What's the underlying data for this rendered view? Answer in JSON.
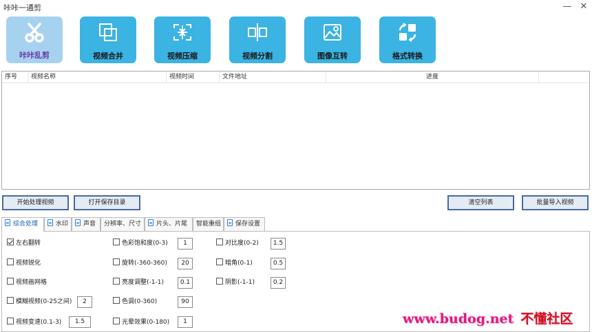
{
  "window": {
    "title": "咔咔一通剪",
    "minimize_symbol": "—",
    "close_symbol": "✕"
  },
  "toolbar": {
    "tools": [
      {
        "label": "咔咔乱剪",
        "icon": "scissors-icon",
        "active": true
      },
      {
        "label": "视频合并",
        "icon": "merge-icon"
      },
      {
        "label": "视频压缩",
        "icon": "compress-icon"
      },
      {
        "label": "视频分割",
        "icon": "split-icon"
      },
      {
        "label": "图像互转",
        "icon": "image-convert-icon"
      },
      {
        "label": "格式转换",
        "icon": "format-convert-icon"
      }
    ]
  },
  "list": {
    "columns": [
      "序号",
      "视频名称",
      "视频时间",
      "文件地址",
      "进度"
    ],
    "rows": []
  },
  "actions": {
    "start": "开始处理视频",
    "open_dir": "打开保存目录",
    "clear": "清空列表",
    "import": "批量导入视频"
  },
  "tabs": [
    {
      "label": "综合处理",
      "icon": true,
      "active": true
    },
    {
      "label": "水印",
      "icon": true
    },
    {
      "label": "声音",
      "icon": true
    },
    {
      "label": "分辨率、尺寸",
      "icon": false
    },
    {
      "label": "片头、片尾",
      "icon": true
    },
    {
      "label": "智能重组",
      "icon": false
    },
    {
      "label": "保存设置",
      "icon": true
    }
  ],
  "options": {
    "flip": {
      "label": "左右翻转",
      "checked": true
    },
    "sharpen": {
      "label": "视频锐化",
      "checked": false
    },
    "grid": {
      "label": "视频画网格",
      "checked": false
    },
    "blur": {
      "label": "模糊视频(0-25之间)",
      "checked": false,
      "value": "2"
    },
    "speed": {
      "label": "视频变速(0.1-3)",
      "checked": false,
      "value": "1.5"
    },
    "saturation": {
      "label": "色彩饱和度(0-3)",
      "checked": false,
      "value": "1"
    },
    "rotate": {
      "label": "旋转(-360-360)",
      "checked": false,
      "value": "20"
    },
    "brightness": {
      "label": "亮度调整(-1-1)",
      "checked": false,
      "value": "0.1"
    },
    "hue": {
      "label": "色调(0-360)",
      "checked": false,
      "value": "90"
    },
    "halo": {
      "label": "光晕效果(0-180)",
      "checked": false,
      "value": "1"
    },
    "contrast": {
      "label": "对比度(0-2)",
      "checked": false,
      "value": "1.5"
    },
    "vignette": {
      "label": "暗角(0-1)",
      "checked": false,
      "value": "0.5"
    },
    "shadow": {
      "label": "阴影(-1-1)",
      "checked": false,
      "value": "0.2"
    }
  },
  "watermark": {
    "url": "www.budog.net",
    "brand": "不懂社区"
  },
  "colors": {
    "tool_bg": "#3bb3e3",
    "tool_active_bg": "#a6d2f0",
    "button_border": "#4a6a99",
    "watermark_pink": "#e0197e",
    "watermark_red": "#d0101a"
  }
}
